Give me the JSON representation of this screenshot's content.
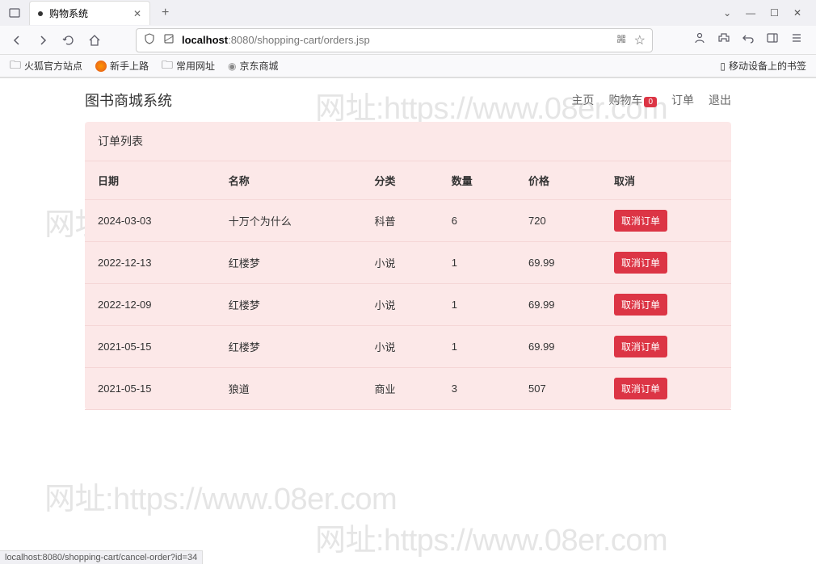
{
  "browser": {
    "tab_title": "购物系统",
    "url_host": "localhost",
    "url_path": ":8080/shopping-cart/orders.jsp",
    "status_bar": "localhost:8080/shopping-cart/cancel-order?id=34"
  },
  "bookmarks": {
    "firefox_official": "火狐官方站点",
    "newbie": "新手上路",
    "common": "常用网址",
    "jd": "京东商城",
    "mobile": "移动设备上的书签"
  },
  "page": {
    "brand": "图书商城系统",
    "nav": {
      "home": "主页",
      "cart": "购物车",
      "cart_count": "0",
      "orders": "订单",
      "logout": "退出"
    },
    "panel_title": "订单列表",
    "watermark": "网址:https://www.08er.com"
  },
  "table": {
    "headers": {
      "date": "日期",
      "name": "名称",
      "category": "分类",
      "qty": "数量",
      "price": "价格",
      "cancel": "取消"
    },
    "cancel_label": "取消订单",
    "rows": [
      {
        "date": "2024-03-03",
        "name": "十万个为什么",
        "category": "科普",
        "qty": "6",
        "price": "720"
      },
      {
        "date": "2022-12-13",
        "name": "红楼梦",
        "category": "小说",
        "qty": "1",
        "price": "69.99"
      },
      {
        "date": "2022-12-09",
        "name": "红楼梦",
        "category": "小说",
        "qty": "1",
        "price": "69.99"
      },
      {
        "date": "2021-05-15",
        "name": "红楼梦",
        "category": "小说",
        "qty": "1",
        "price": "69.99"
      },
      {
        "date": "2021-05-15",
        "name": "狼道",
        "category": "商业",
        "qty": "3",
        "price": "507"
      }
    ]
  }
}
